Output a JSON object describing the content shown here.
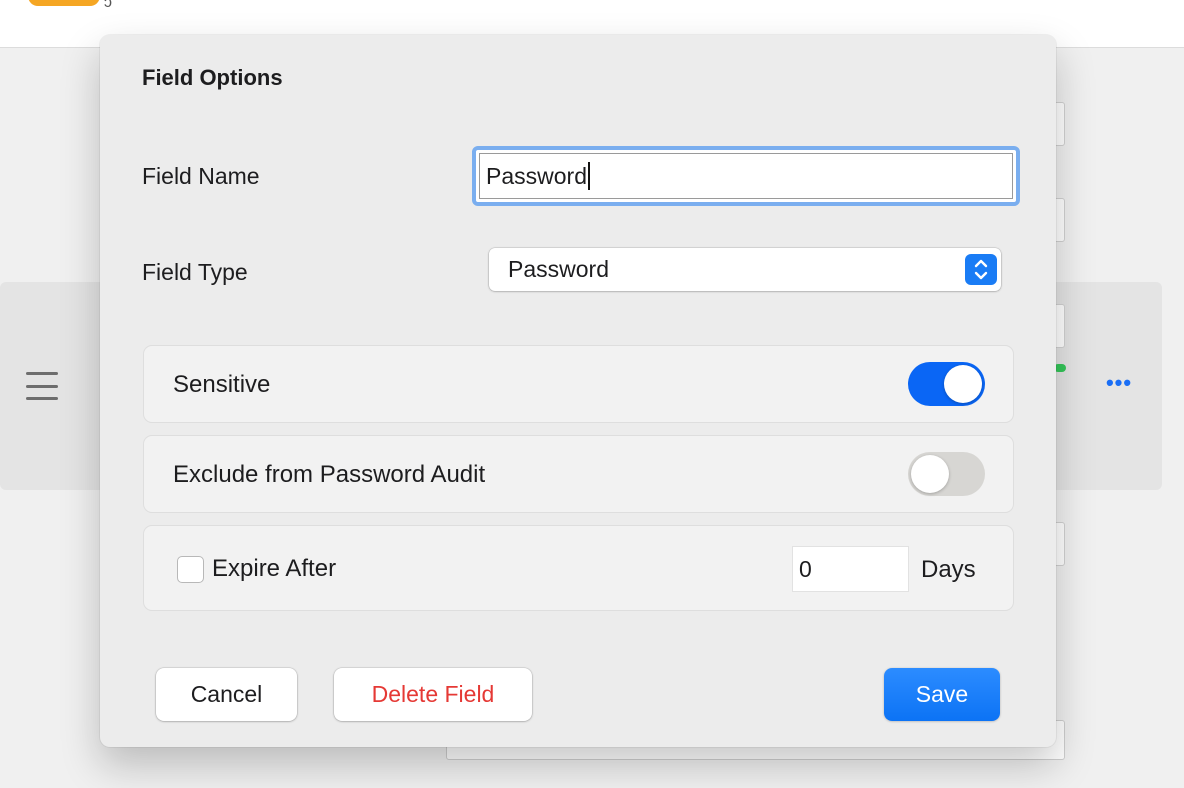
{
  "dialog": {
    "title": "Field Options",
    "field_name_label": "Field Name",
    "field_name_value": "Password",
    "field_type_label": "Field Type",
    "field_type_value": "Password",
    "sensitive_label": "Sensitive",
    "sensitive_on": true,
    "exclude_audit_label": "Exclude from Password Audit",
    "exclude_audit_on": false,
    "expire_label": "Expire After",
    "expire_checked": false,
    "expire_value": "0",
    "expire_unit": "Days",
    "cancel_label": "Cancel",
    "delete_label": "Delete Field",
    "save_label": "Save"
  },
  "background": {
    "more_glyph": "•••"
  },
  "colors": {
    "accent": "#0a66f5",
    "focus_ring": "#7aaeef",
    "delete_red": "#e53935",
    "status_green": "#34c759",
    "warning_orange": "#f5a623"
  },
  "icons": {
    "menu": "hamburger-icon",
    "more": "ellipsis-icon",
    "select": "chevron-up-down-icon"
  }
}
